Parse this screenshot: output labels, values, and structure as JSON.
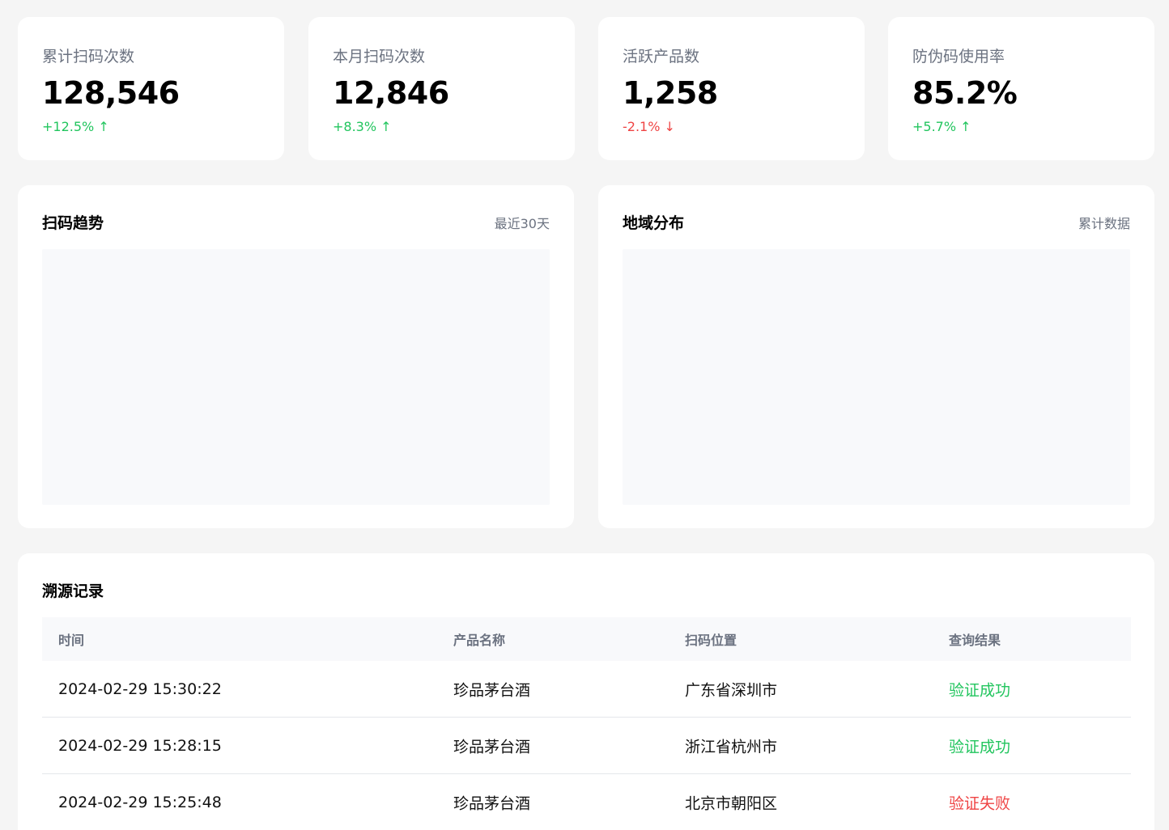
{
  "stats": [
    {
      "label": "累计扫码次数",
      "value": "128,546",
      "change": "+12.5% ↑",
      "trend": "up"
    },
    {
      "label": "本月扫码次数",
      "value": "12,846",
      "change": "+8.3% ↑",
      "trend": "up"
    },
    {
      "label": "活跃产品数",
      "value": "1,258",
      "change": "-2.1% ↓",
      "trend": "down"
    },
    {
      "label": "防伪码使用率",
      "value": "85.2%",
      "change": "+5.7% ↑",
      "trend": "up"
    }
  ],
  "trend_panel": {
    "title": "扫码趋势",
    "subtitle": "最近30天"
  },
  "region_panel": {
    "title": "地域分布",
    "subtitle": "累计数据"
  },
  "records": {
    "title": "溯源记录",
    "columns": [
      "时间",
      "产品名称",
      "扫码位置",
      "查询结果"
    ],
    "rows": [
      {
        "time": "2024-02-29 15:30:22",
        "product": "珍品茅台酒",
        "location": "广东省深圳市",
        "result": "验证成功",
        "status": "success"
      },
      {
        "time": "2024-02-29 15:28:15",
        "product": "珍品茅台酒",
        "location": "浙江省杭州市",
        "result": "验证成功",
        "status": "success"
      },
      {
        "time": "2024-02-29 15:25:48",
        "product": "珍品茅台酒",
        "location": "北京市朝阳区",
        "result": "验证失败",
        "status": "fail"
      }
    ]
  },
  "colors": {
    "up": "#22c55e",
    "down": "#ef4444",
    "background": "#f5f5f5"
  }
}
